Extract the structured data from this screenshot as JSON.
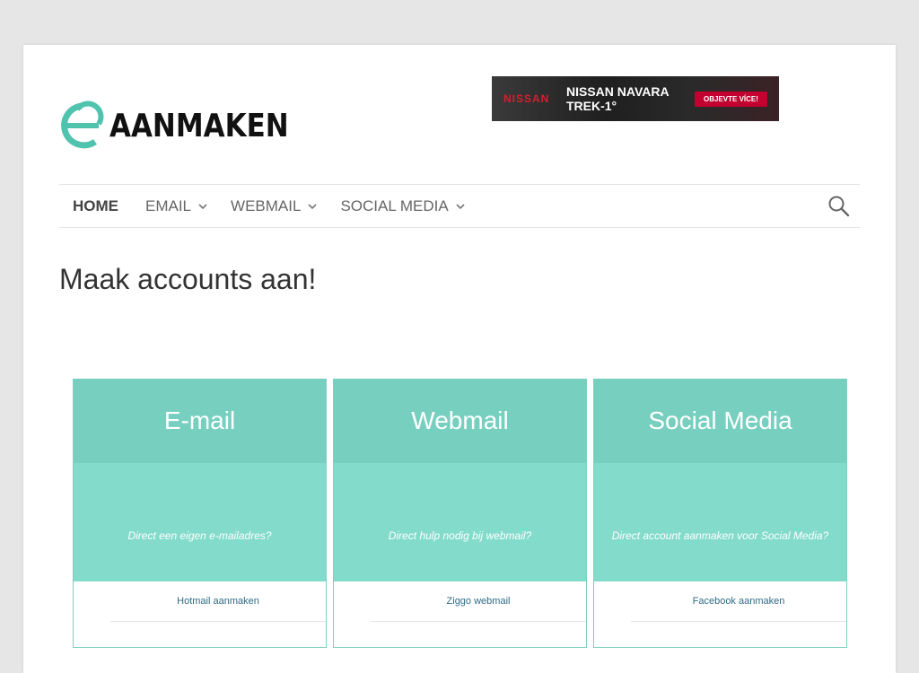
{
  "site": {
    "logo_text": "AANMAKEN",
    "logo_color": "#4fc3ad"
  },
  "ad": {
    "brand": "NISSAN",
    "title": "NISSAN NAVARA TREK-1°",
    "button": "OBJEVTE VÍCE!"
  },
  "nav": {
    "items": [
      {
        "label": "HOME",
        "has_dropdown": false
      },
      {
        "label": "EMAIL",
        "has_dropdown": true
      },
      {
        "label": "WEBMAIL",
        "has_dropdown": true
      },
      {
        "label": "SOCIAL MEDIA",
        "has_dropdown": true
      }
    ],
    "search_icon": "search-icon"
  },
  "page_title": "Maak accounts aan!",
  "cards": [
    {
      "title": "E-mail",
      "subtitle": "Direct een eigen e-mailadres?",
      "link": "Hotmail aanmaken"
    },
    {
      "title": "Webmail",
      "subtitle": "Direct hulp nodig bij webmail?",
      "link": "Ziggo webmail"
    },
    {
      "title": "Social Media",
      "subtitle": "Direct account aanmaken voor Social Media?",
      "link": "Facebook aanmaken"
    }
  ],
  "colors": {
    "card_head": "#77cfbf",
    "card_body": "#83dbcb",
    "link": "#2e6b86"
  }
}
